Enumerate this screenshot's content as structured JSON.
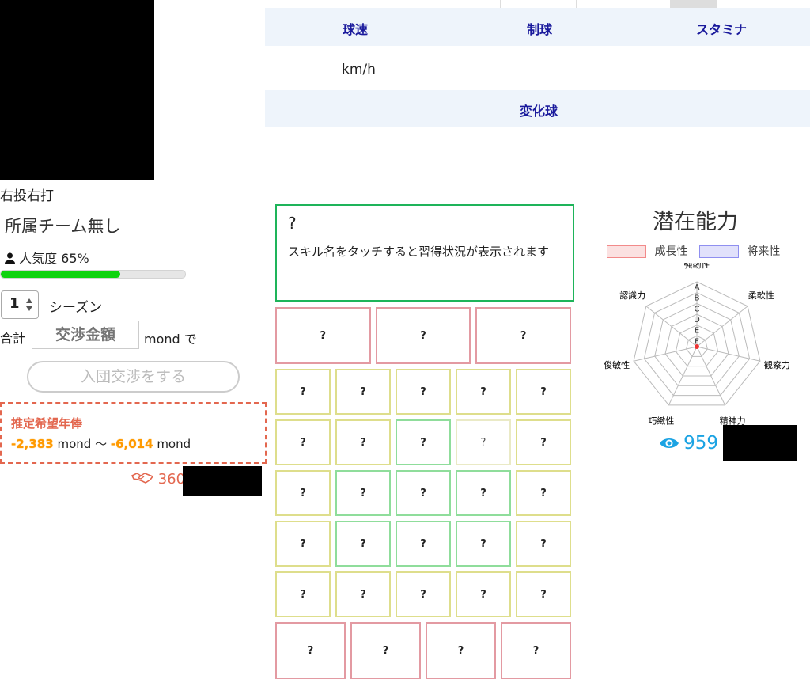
{
  "stats": {
    "headers": [
      "球速",
      "制球",
      "スタミナ"
    ],
    "speed_unit": "km/h",
    "breaking_header": "変化球"
  },
  "player": {
    "hand": "右投右打",
    "team": "所属チーム無し",
    "popularity_label": "人気度 65%",
    "popularity_value": 0.65
  },
  "negotiation": {
    "seasons_value": "1",
    "seasons_label": "シーズン",
    "total_label": "合計",
    "amount_placeholder": "交渉金額",
    "currency_suffix": "mond で",
    "join_button": "入団交渉をする"
  },
  "salary": {
    "title": "推定希望年俸",
    "min": "-2,383",
    "min_unit": "mond",
    "separator": "〜",
    "max": "-6,014",
    "max_unit": "mond"
  },
  "likes": {
    "count": "360"
  },
  "skill_info": {
    "name": "?",
    "hint": "スキル名をタッチすると習得状況が表示されます"
  },
  "skills": {
    "label": "?",
    "rows": [
      [
        "red",
        "red",
        "red"
      ],
      [
        "yellow",
        "yellow",
        "yellow",
        "yellow",
        "yellow"
      ],
      [
        "yellow",
        "yellow",
        "green",
        "pale",
        "yellow"
      ],
      [
        "yellow",
        "green",
        "green",
        "green",
        "yellow"
      ],
      [
        "yellow",
        "green",
        "green",
        "green",
        "yellow"
      ],
      [
        "yellow",
        "yellow",
        "yellow",
        "yellow",
        "yellow"
      ],
      [
        "red",
        "red",
        "red",
        "red"
      ]
    ]
  },
  "potential": {
    "title": "潜在能力",
    "legend_growth": "成長性",
    "legend_future": "将来性",
    "axes": [
      "強靭性",
      "柔軟性",
      "観察力",
      "精神力",
      "巧緻性",
      "俊敏性",
      "認識力"
    ],
    "grades": [
      "A",
      "B",
      "C",
      "D",
      "E",
      "F"
    ],
    "view_count": "959"
  },
  "colors": {
    "growth": "#f28a8a",
    "future": "#8f8ff0",
    "accent_green": "#0fd30f",
    "salary": "#e3674f",
    "eye": "#1ba3e3"
  }
}
